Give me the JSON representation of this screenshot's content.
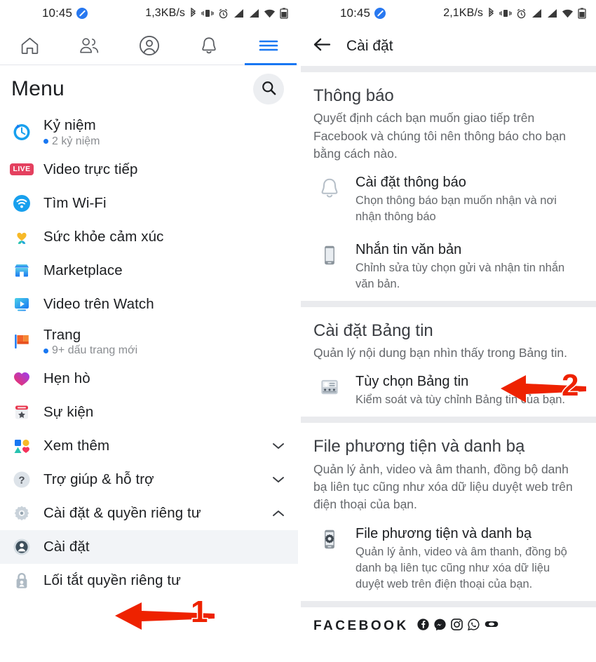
{
  "colors": {
    "fb_blue": "#1877f2",
    "annotation_red": "#ee2200",
    "text_primary": "#1c1e21",
    "text_secondary": "#65686c",
    "divider": "#eaebee",
    "selected_row": "#f2f4f7"
  },
  "left_pane": {
    "status_bar": {
      "time": "10:45",
      "network_speed": "1,3KB/s",
      "icons": [
        "shield-badge-icon",
        "bluetooth-icon",
        "vibrate-icon",
        "alarm-icon",
        "signal-1-icon",
        "signal-2-icon",
        "wifi-icon",
        "battery-icon"
      ]
    },
    "tabs": [
      {
        "name": "home",
        "icon": "home-icon",
        "active": false
      },
      {
        "name": "friends",
        "icon": "friends-icon",
        "active": false
      },
      {
        "name": "profile",
        "icon": "profile-circle-icon",
        "active": false
      },
      {
        "name": "notifications",
        "icon": "bell-icon",
        "active": false
      },
      {
        "name": "menu",
        "icon": "hamburger-icon",
        "active": true
      }
    ],
    "header": {
      "title": "Menu",
      "search_icon": "search-icon"
    },
    "menu_items": [
      {
        "label": "Kỷ niệm",
        "sub": "2 kỷ niệm",
        "icon": "memories-clock-icon",
        "chevron": "",
        "selected": false
      },
      {
        "label": "Video trực tiếp",
        "sub": "",
        "icon": "live-badge-icon",
        "badge_text": "LIVE",
        "chevron": "",
        "selected": false
      },
      {
        "label": "Tìm Wi-Fi",
        "sub": "",
        "icon": "wifi-circle-icon",
        "chevron": "",
        "selected": false
      },
      {
        "label": "Sức khỏe cảm xúc",
        "sub": "",
        "icon": "emotional-health-icon",
        "chevron": "",
        "selected": false
      },
      {
        "label": "Marketplace",
        "sub": "",
        "icon": "marketplace-storefront-icon",
        "chevron": "",
        "selected": false
      },
      {
        "label": "Video trên Watch",
        "sub": "",
        "icon": "watch-video-icon",
        "chevron": "",
        "selected": false
      },
      {
        "label": "Trang",
        "sub": "9+ dấu trang mới",
        "icon": "pages-flag-icon",
        "chevron": "",
        "selected": false
      },
      {
        "label": "Hẹn hò",
        "sub": "",
        "icon": "dating-heart-icon",
        "chevron": "",
        "selected": false
      },
      {
        "label": "Sự kiện",
        "sub": "",
        "icon": "events-calendar-icon",
        "chevron": "",
        "selected": false
      },
      {
        "label": "Xem thêm",
        "sub": "",
        "icon": "see-more-shapes-icon",
        "chevron": "chevron-down-icon",
        "selected": false
      },
      {
        "label": "Trợ giúp & hỗ trợ",
        "sub": "",
        "icon": "help-question-icon",
        "chevron": "chevron-down-icon",
        "selected": false
      },
      {
        "label": "Cài đặt & quyền riêng tư",
        "sub": "",
        "icon": "settings-gear-icon",
        "chevron": "chevron-up-icon",
        "selected": false
      },
      {
        "label": "Cài đặt",
        "sub": "",
        "icon": "account-settings-icon",
        "chevron": "",
        "selected": true
      },
      {
        "label": "Lối tắt quyền riêng tư",
        "sub": "",
        "icon": "privacy-lock-icon",
        "chevron": "",
        "selected": false
      }
    ],
    "annotation": {
      "number": "1",
      "arrow": "left-arrow-annotation"
    }
  },
  "right_pane": {
    "status_bar": {
      "time": "10:45",
      "network_speed": "2,1KB/s",
      "icons": [
        "shield-badge-icon",
        "bluetooth-icon",
        "vibrate-icon",
        "alarm-icon",
        "signal-1-icon",
        "signal-2-icon",
        "wifi-icon",
        "battery-icon"
      ]
    },
    "app_bar": {
      "back_icon": "back-arrow-icon",
      "title": "Cài đặt"
    },
    "sections": [
      {
        "title": "Thông báo",
        "description": "Quyết định cách bạn muốn giao tiếp trên Facebook và chúng tôi nên thông báo cho bạn bằng cách nào.",
        "rows": [
          {
            "icon": "bell-outline-icon",
            "title": "Cài đặt thông báo",
            "desc": "Chọn thông báo bạn muốn nhận và nơi nhận thông báo"
          },
          {
            "icon": "phone-icon",
            "title": "Nhắn tin văn bản",
            "desc": "Chỉnh sửa tùy chọn gửi và nhận tin nhắn văn bản."
          }
        ]
      },
      {
        "title": "Cài đặt Bảng tin",
        "description": "Quản lý nội dung bạn nhìn thấy trong Bảng tin.",
        "rows": [
          {
            "icon": "news-feed-preferences-icon",
            "title": "Tùy chọn Bảng tin",
            "desc": "Kiểm soát và tùy chỉnh Bảng tin của bạn."
          }
        ]
      },
      {
        "title": "File phương tiện và danh bạ",
        "description": "Quản lý ảnh, video và âm thanh, đồng bộ danh bạ liên tục cũng như xóa dữ liệu duyệt web trên điện thoại của bạn.",
        "rows": [
          {
            "icon": "phone-gear-icon",
            "title": "File phương tiện và danh bạ",
            "desc": "Quản lý ảnh, video và âm thanh, đồng bộ danh bạ liên tục cũng như xóa dữ liệu duyệt web trên điện thoại của bạn."
          }
        ]
      }
    ],
    "footer": {
      "brand": "FACEBOOK",
      "icons": [
        "facebook-icon",
        "messenger-icon",
        "instagram-icon",
        "whatsapp-icon",
        "oculus-icon"
      ]
    },
    "annotation": {
      "number": "2",
      "arrow": "left-arrow-annotation"
    }
  }
}
